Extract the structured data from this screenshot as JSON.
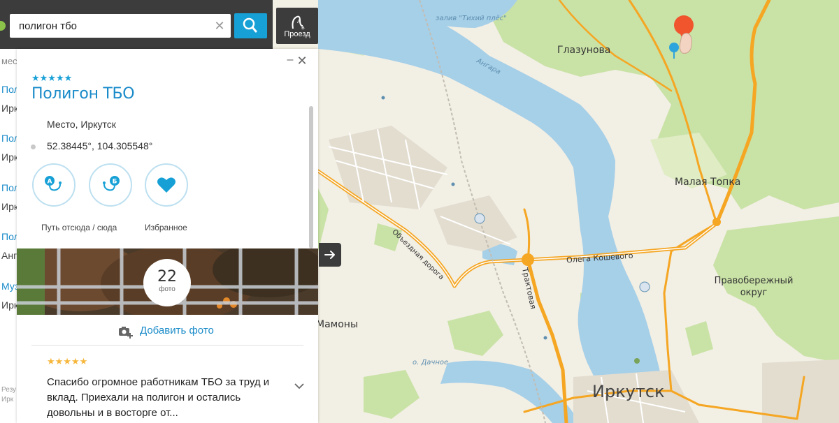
{
  "search": {
    "value": "полигон тбо"
  },
  "route_button": {
    "label": "Проезд"
  },
  "background_list": {
    "rows": [
      "мест",
      "Пол",
      "Ирк",
      "Пол",
      "Ирк",
      "Пол",
      "Ирк",
      "Пол",
      "Анг",
      "Муз",
      "Ирк",
      "Резу",
      "Ирк"
    ]
  },
  "card": {
    "rating": "★★★★★",
    "title": "Полигон ТБО",
    "place_type": "Место, Иркутск",
    "coordinates": "52.38445°, 104.305548°",
    "action_route_label": "Путь отсюда / сюда",
    "action_favorite_label": "Избранное",
    "photo_count": "22",
    "photo_count_label": "фото",
    "add_photo_label": "Добавить фото",
    "review": {
      "rating": "★★★★★",
      "text": "Спасибо огромное работникам ТБО за труд и вклад. Приехали на полигон и остались довольны и в восторге от..."
    }
  },
  "map": {
    "labels": {
      "glazunova": "Глазунова",
      "malaya_topka": "Малая Топка",
      "pravoberezhny": "Правобережный округ",
      "irkutsk": "Иркутск",
      "mamony": "Мамоны",
      "zaliv": "залив \"Тихий плёс\"",
      "angara": "Ангара",
      "dachnoe": "о. Дачное",
      "olega_kosheva": "Олега Кошевого",
      "traktovaya": "Трактовая",
      "obezdnaya": "Объездная дорога"
    },
    "colors": {
      "river": "#a6cfe8",
      "forest": "#c9e2a6",
      "road": "#f5a623",
      "land": "#f2efe4",
      "accent": "#17a0d6"
    }
  }
}
